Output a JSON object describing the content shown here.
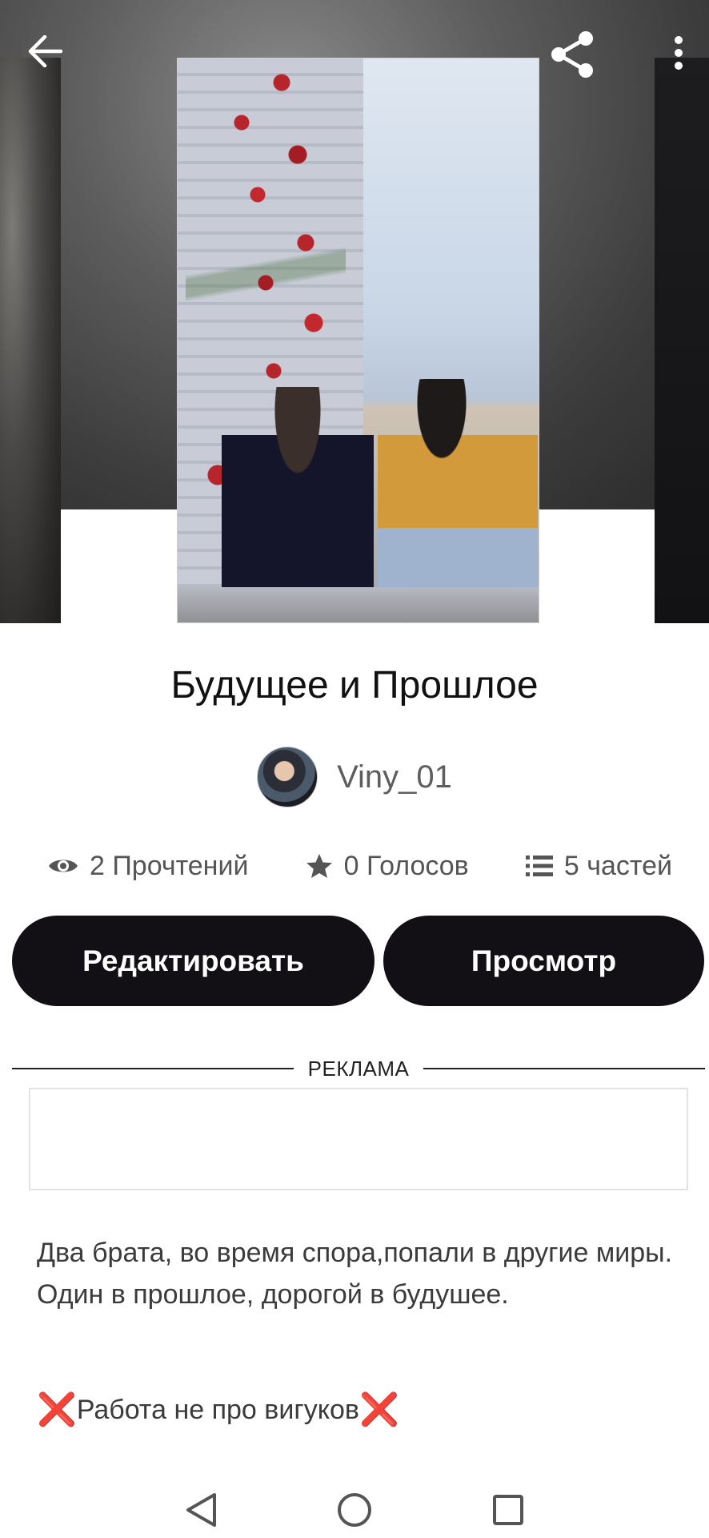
{
  "header": {
    "back_icon": "arrow-left-icon",
    "share_icon": "share-icon",
    "more_icon": "more-vertical-icon"
  },
  "story": {
    "title": "Будущее и Прошлое",
    "author": "Viny_01"
  },
  "stats": {
    "reads": "2 Прочтений",
    "votes": "0 Голосов",
    "parts": "5 частей"
  },
  "actions": {
    "edit_label": "Редактировать",
    "view_label": "Просмотр"
  },
  "ad": {
    "label": "РЕКЛАМА"
  },
  "description": {
    "text": "Два брата, во время  спора,попали в другие миры. Один в прошлое, дорогой в будушее.",
    "note": "Работа не про вигуков"
  },
  "colors": {
    "button_bg": "#121014",
    "button_text": "#ffffff",
    "note_cross": "#d8262e"
  },
  "navbar": {
    "back_icon": "triangle-back-icon",
    "home_icon": "circle-home-icon",
    "recents_icon": "square-recents-icon"
  }
}
